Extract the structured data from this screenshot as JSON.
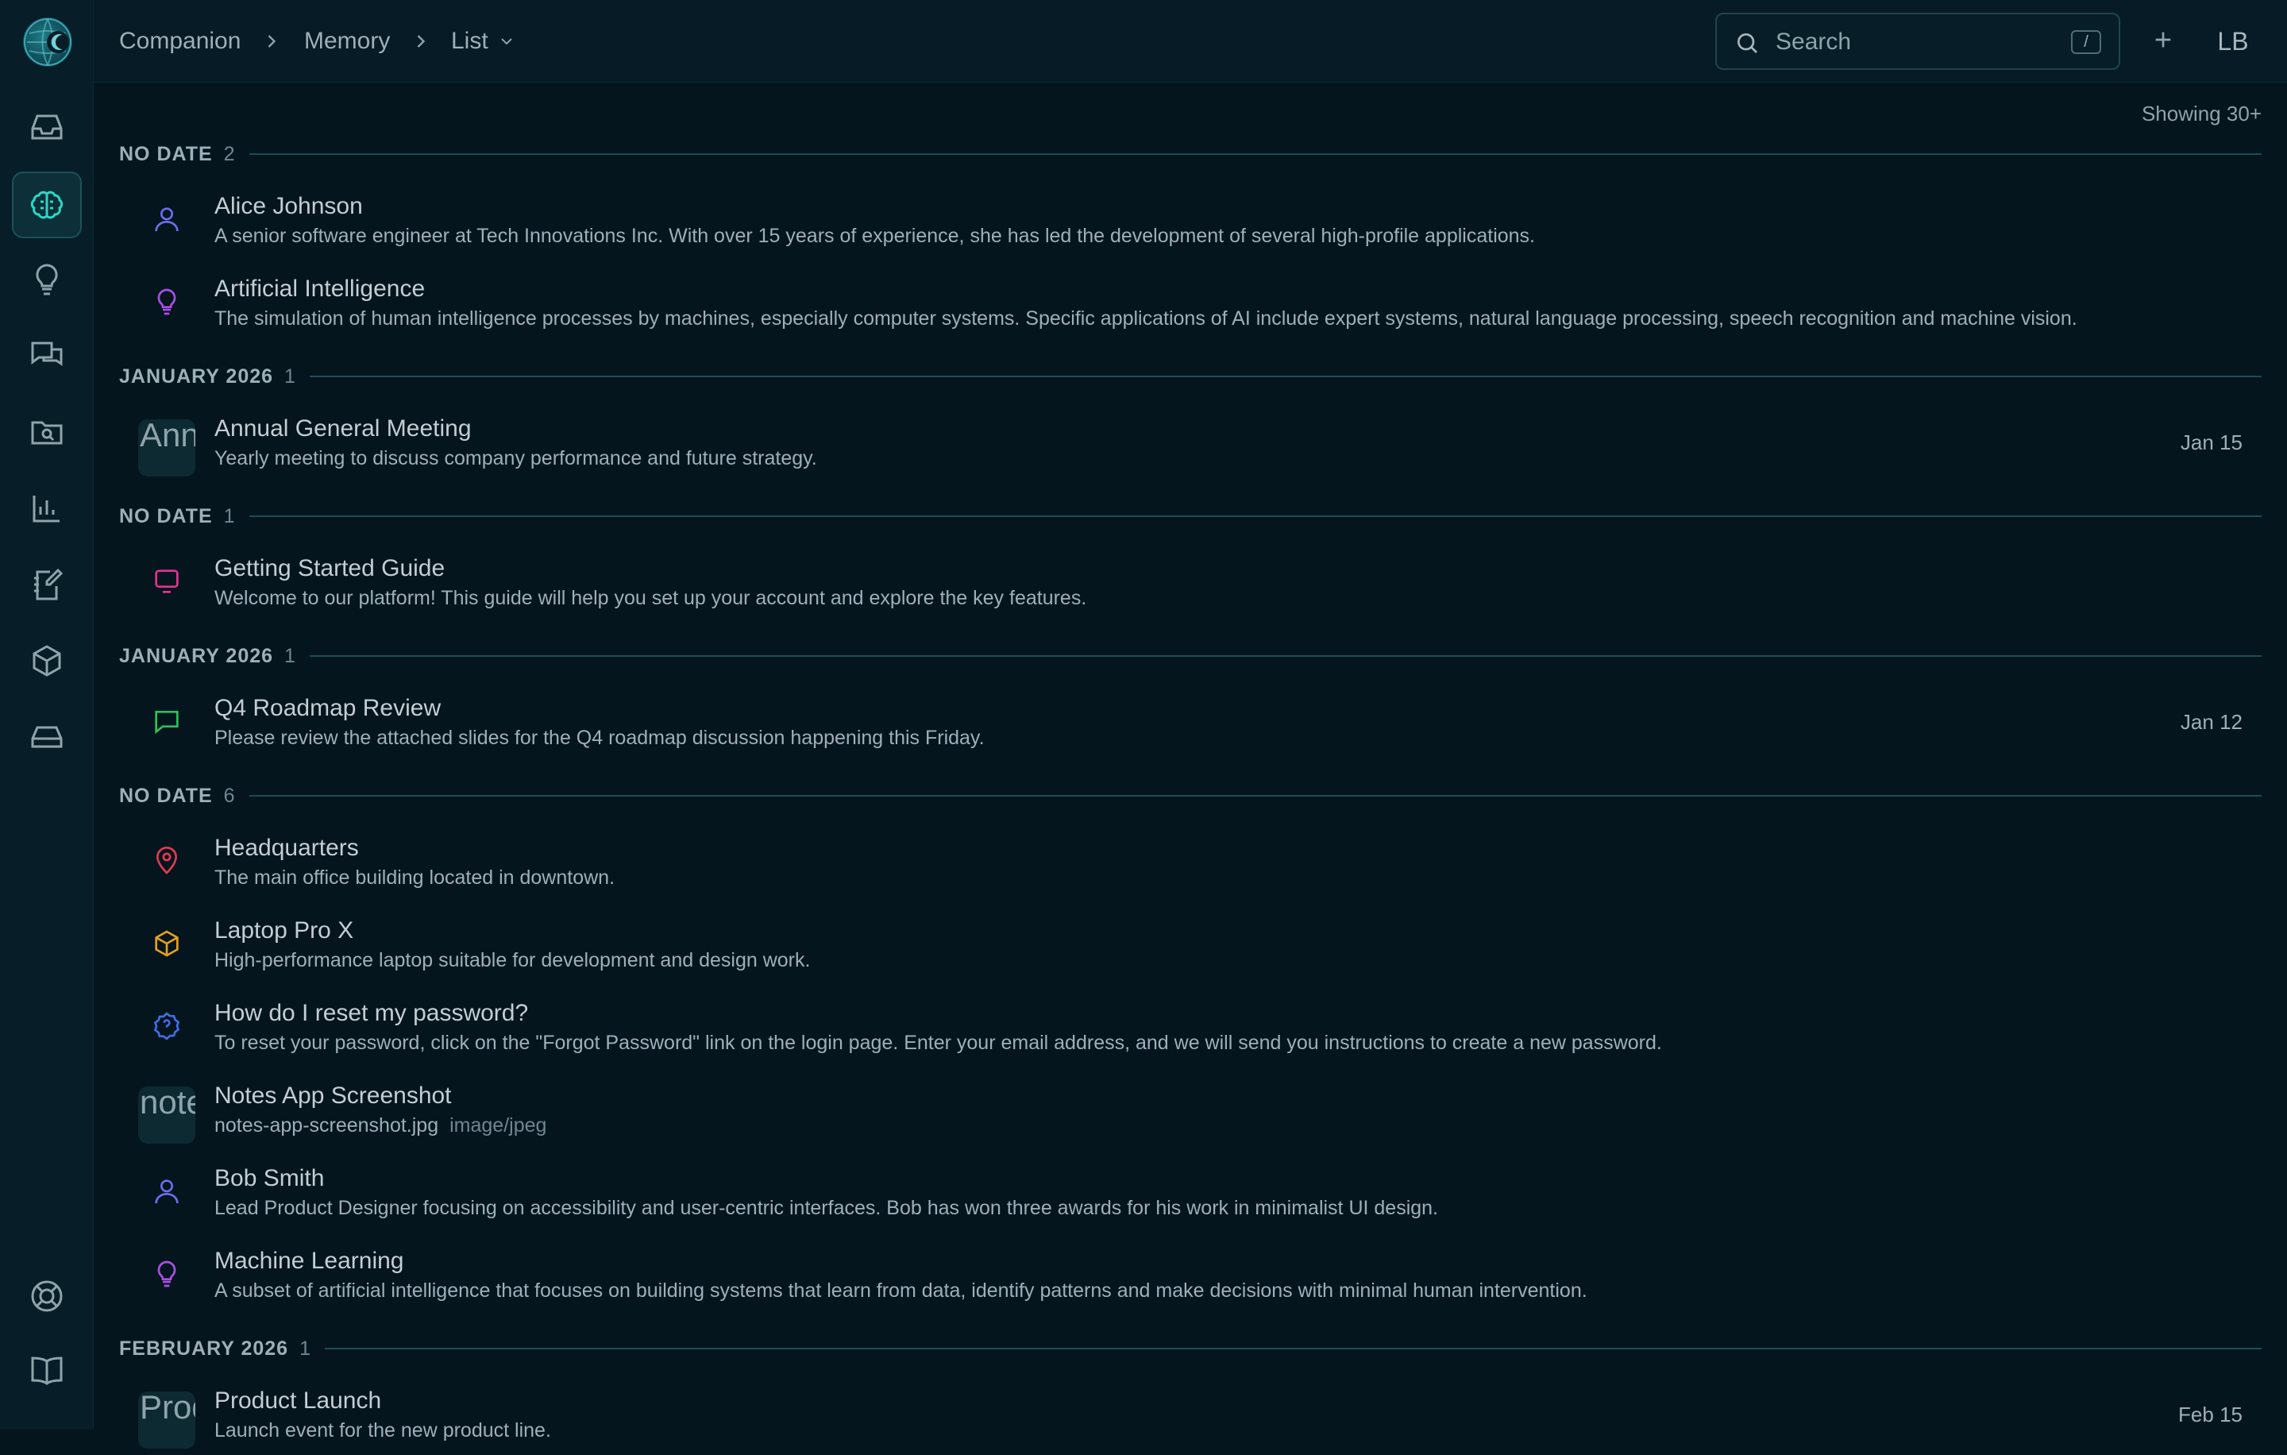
{
  "breadcrumb": {
    "root": "Companion",
    "section": "Memory",
    "view": "List"
  },
  "search": {
    "placeholder": "Search",
    "shortcut": "/"
  },
  "user": {
    "initials": "LB"
  },
  "rail": {
    "items": [
      {
        "icon": "inbox-icon"
      },
      {
        "icon": "brain-icon",
        "active": true
      },
      {
        "icon": "lightbulb-icon"
      },
      {
        "icon": "chat-icon"
      },
      {
        "icon": "folder-search-icon"
      },
      {
        "icon": "bar-chart-icon"
      },
      {
        "icon": "notebook-pen-icon"
      },
      {
        "icon": "box-icon"
      },
      {
        "icon": "hard-drive-icon"
      },
      {
        "icon": "lifebuoy-icon"
      },
      {
        "icon": "book-icon"
      }
    ]
  },
  "showing": "Showing 30+",
  "groups": [
    {
      "title": "NO DATE",
      "count": "2"
    },
    {
      "title": "JANUARY 2026",
      "count": "1"
    },
    {
      "title": "NO DATE",
      "count": "1"
    },
    {
      "title": "JANUARY 2026",
      "count": "1"
    },
    {
      "title": "NO DATE",
      "count": "6"
    },
    {
      "title": "FEBRUARY 2026",
      "count": "1"
    }
  ],
  "items": [
    {
      "title": "Alice Johnson",
      "desc": "A senior software engineer at Tech Innovations Inc. With over 15 years of experience, she has led the development of several high-profile applications.",
      "icon": "person-icon",
      "color": "#6d6ef0"
    },
    {
      "title": "Artificial Intelligence",
      "desc": "The simulation of human intelligence processes by machines, especially computer systems. Specific applications of AI include expert systems, natural language processing, speech recognition and machine vision.",
      "icon": "lightbulb-icon",
      "color": "#a84ee6"
    },
    {
      "title": "Annual General Meeting",
      "desc": "Yearly meeting to discuss company performance and future strategy.",
      "thumb": "Annu",
      "date": "Jan 15"
    },
    {
      "title": "Getting Started Guide",
      "desc": "Welcome to our platform! This guide will help you set up your account and explore the key features.",
      "icon": "monitor-icon",
      "color": "#e0358f"
    },
    {
      "title": "Q4 Roadmap Review",
      "desc": "Please review the attached slides for the Q4 roadmap discussion happening this Friday.",
      "icon": "message-icon",
      "color": "#2fbf5a",
      "date": "Jan 12"
    },
    {
      "title": "Headquarters",
      "desc": "The main office building located in downtown.",
      "icon": "map-pin-icon",
      "color": "#e23a4f"
    },
    {
      "title": "Laptop Pro X",
      "desc": "High-performance laptop suitable for development and design work.",
      "icon": "box-icon",
      "color": "#e6a21a"
    },
    {
      "title": "How do I reset my password?",
      "desc": "To reset your password, click on the \"Forgot Password\" link on the login page. Enter your email address, and we will send you instructions to create a new password.",
      "icon": "question-icon",
      "color": "#3f6fe6"
    },
    {
      "title": "Notes App Screenshot",
      "desc": "notes-app-screenshot.jpg",
      "mime": "image/jpeg",
      "thumb": "note"
    },
    {
      "title": "Bob Smith",
      "desc": "Lead Product Designer focusing on accessibility and user-centric interfaces. Bob has won three awards for his work in minimalist UI design.",
      "icon": "person-icon",
      "color": "#6d6ef0"
    },
    {
      "title": "Machine Learning",
      "desc": "A subset of artificial intelligence that focuses on building systems that learn from data, identify patterns and make decisions with minimal human intervention.",
      "icon": "lightbulb-icon",
      "color": "#a84ee6"
    },
    {
      "title": "Product Launch",
      "desc": "Launch event for the new product line.",
      "thumb": "Prod",
      "date": "Feb 15"
    }
  ]
}
